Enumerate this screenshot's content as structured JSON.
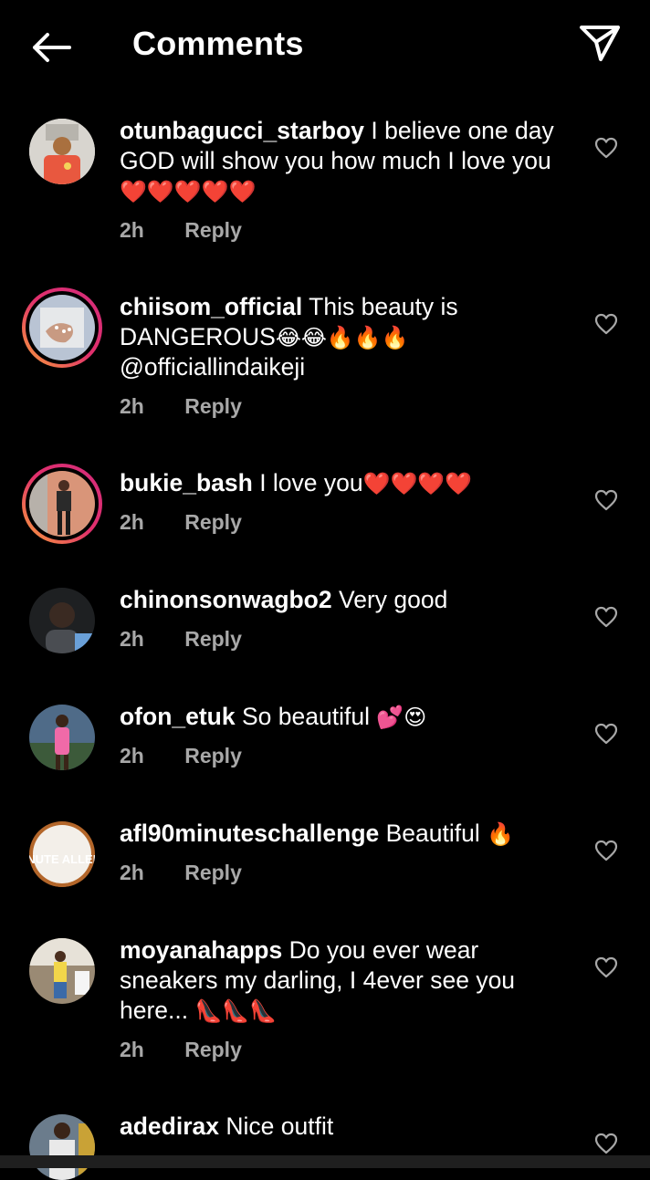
{
  "header": {
    "title": "Comments",
    "back_icon": "arrow-left-icon",
    "send_icon": "paper-plane-icon"
  },
  "comments": [
    {
      "username": "otunbagucci_starboy",
      "text": "I believe one day GOD will show you how much I love you",
      "emoji": "❤️❤️❤️❤️❤️",
      "time": "2h",
      "reply": "Reply",
      "avatar_color": "#e8583f",
      "story_ring": false
    },
    {
      "username": "chiisom_official",
      "text": "This beauty is DANGEROUS",
      "emoji": "😂😂🔥🔥🔥",
      "mention": "@officiallindaikeji",
      "time": "2h",
      "reply": "Reply",
      "avatar_color": "#b9c4d4",
      "story_ring": true
    },
    {
      "username": "bukie_bash",
      "text": "I love you",
      "emoji": "❤️❤️❤️❤️",
      "time": "2h",
      "reply": "Reply",
      "avatar_color": "#d99579",
      "story_ring": true
    },
    {
      "username": "chinonsonwagbo2",
      "text": "Very good",
      "time": "2h",
      "reply": "Reply",
      "avatar_color": "#2c2f33",
      "story_ring": false
    },
    {
      "username": "ofon_etuk",
      "text": "So beautiful",
      "emoji": "💕😍",
      "time": "2h",
      "reply": "Reply",
      "avatar_color": "#4f6b88",
      "story_ring": false
    },
    {
      "username": "afl90minuteschallenge",
      "text": "Beautiful",
      "emoji": "🔥",
      "time": "2h",
      "reply": "Reply",
      "avatar_color": "#b3662a",
      "avatar_text": "MINUTE ALLENG",
      "story_ring": false
    },
    {
      "username": "moyanahapps",
      "text": "Do you ever wear sneakers my darling, I 4ever see you here...",
      "emoji": "👠👠👠",
      "time": "2h",
      "reply": "Reply",
      "avatar_color": "#8a7a66",
      "story_ring": false
    },
    {
      "username": "adedirax",
      "text": "Nice outfit",
      "avatar_color": "#6b7c8c",
      "story_ring": false
    }
  ]
}
